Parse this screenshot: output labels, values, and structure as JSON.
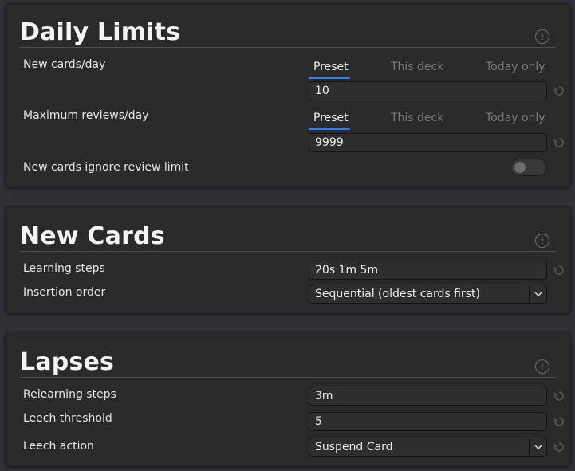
{
  "daily_limits": {
    "title": "Daily Limits",
    "new_cards_label": "New cards/day",
    "new_cards_tabs": [
      "Preset",
      "This deck",
      "Today only"
    ],
    "new_cards_value": "10",
    "max_reviews_label": "Maximum reviews/day",
    "max_reviews_tabs": [
      "Preset",
      "This deck",
      "Today only"
    ],
    "max_reviews_value": "9999",
    "ignore_review_limit_label": "New cards ignore review limit",
    "ignore_review_limit_enabled": false,
    "active_tab": "Preset"
  },
  "new_cards": {
    "title": "New Cards",
    "learning_steps_label": "Learning steps",
    "learning_steps_value": "20s 1m 5m",
    "insertion_order_label": "Insertion order",
    "insertion_order_value": "Sequential (oldest cards first)"
  },
  "lapses": {
    "title": "Lapses",
    "relearning_steps_label": "Relearning steps",
    "relearning_steps_value": "3m",
    "leech_threshold_label": "Leech threshold",
    "leech_threshold_value": "5",
    "leech_action_label": "Leech action",
    "leech_action_value": "Suspend Card"
  },
  "icons": {
    "info_glyph": "i",
    "info": "info-icon",
    "revert": "revert-icon",
    "dropdown": "chevron-down-icon"
  },
  "colors": {
    "accent": "#3f7be0",
    "background": "#2f3136",
    "panel": "#2a2a2a"
  }
}
